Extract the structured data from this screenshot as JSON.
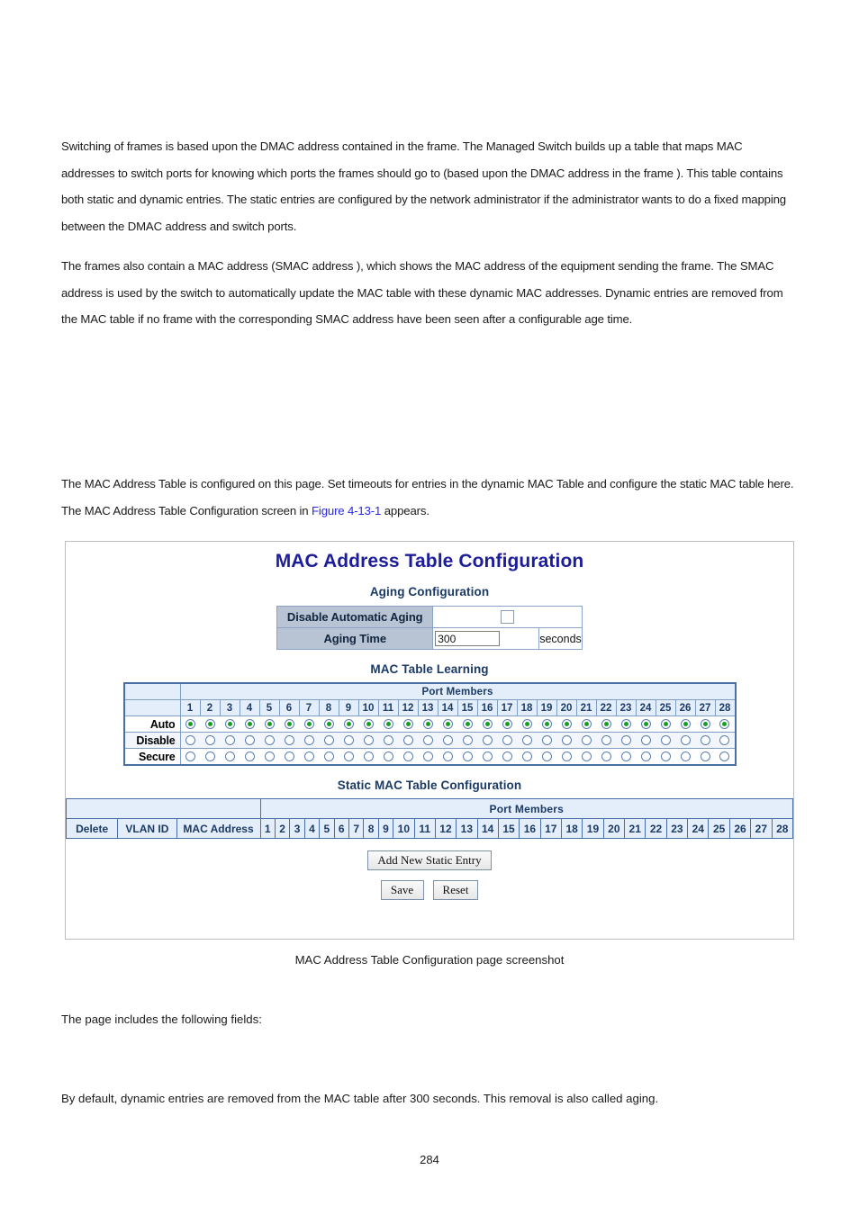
{
  "document": {
    "paragraphs": [
      "Switching of frames is based upon the DMAC address contained in the frame. The Managed Switch builds up a table that maps MAC addresses to switch ports for knowing which ports the frames should go to (based upon the DMAC address in the frame ). This table contains both static and dynamic entries. The static entries are configured by the network administrator if the administrator wants to do a fixed mapping between the DMAC address and switch ports.",
      "The frames also contain a MAC address (SMAC address ), which shows the MAC address of the equipment sending the frame. The SMAC address is used by the switch to automatically update the MAC table with these dynamic MAC addresses. Dynamic entries are removed from the MAC table if no frame with the corresponding SMAC address have been seen after a configurable age time."
    ],
    "intro": {
      "before_link": "The MAC Address Table is configured on this page. Set timeouts for entries in the dynamic MAC Table and configure the static MAC table here. The MAC Address Table Configuration screen in ",
      "link_text": "Figure 4-13-1",
      "after_link": " appears."
    },
    "figure_caption": "MAC Address Table Configuration page screenshot",
    "tail_text_1": "The page includes the following fields:",
    "tail_text_2": "By default, dynamic entries are removed from the MAC table after 300 seconds. This removal is also called aging.",
    "page_number": "284"
  },
  "screenshot": {
    "title": "MAC Address Table Configuration",
    "aging": {
      "heading": "Aging Configuration",
      "disable_label": "Disable Automatic Aging",
      "disable_checked": false,
      "aging_time_label": "Aging Time",
      "aging_time_value": "300",
      "unit_label": "seconds"
    },
    "learning": {
      "heading": "MAC Table Learning",
      "port_members_label": "Port Members",
      "ports": [
        1,
        2,
        3,
        4,
        5,
        6,
        7,
        8,
        9,
        10,
        11,
        12,
        13,
        14,
        15,
        16,
        17,
        18,
        19,
        20,
        21,
        22,
        23,
        24,
        25,
        26,
        27,
        28
      ],
      "rows": [
        {
          "label": "Auto",
          "selected": true
        },
        {
          "label": "Disable",
          "selected": false
        },
        {
          "label": "Secure",
          "selected": false
        }
      ]
    },
    "static_table": {
      "heading": "Static MAC Table Configuration",
      "port_members_label": "Port Members",
      "columns": [
        "Delete",
        "VLAN ID",
        "MAC Address"
      ],
      "ports": [
        1,
        2,
        3,
        4,
        5,
        6,
        7,
        8,
        9,
        10,
        11,
        12,
        13,
        14,
        15,
        16,
        17,
        18,
        19,
        20,
        21,
        22,
        23,
        24,
        25,
        26,
        27,
        28
      ]
    },
    "buttons": {
      "add_new": "Add New Static Entry",
      "save": "Save",
      "reset": "Reset"
    },
    "colors": {
      "title": "#1d1d9c",
      "section_head": "#1b3a66",
      "table_header_bg": "#e4eefb",
      "aging_label_bg": "#b8c4d4",
      "radio_on": "#11a11e",
      "link": "#2727e6"
    }
  }
}
